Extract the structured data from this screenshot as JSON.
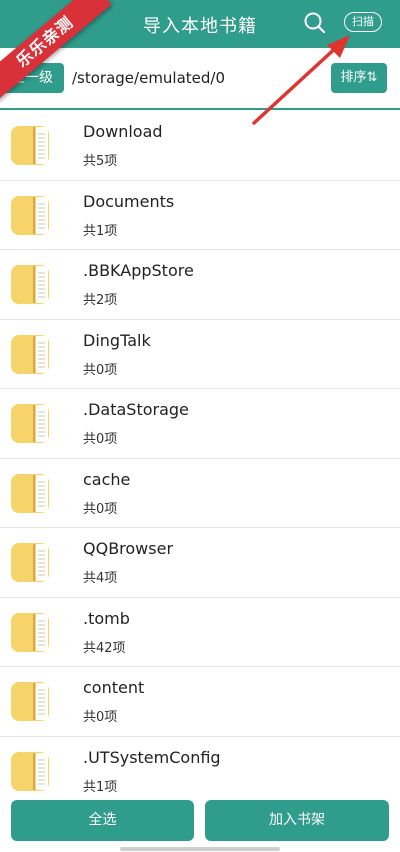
{
  "header": {
    "title": "导入本地书籍",
    "scan_label": "扫描"
  },
  "watermark": "乐乐亲测",
  "pathbar": {
    "up_label": "上一级",
    "path": "/storage/emulated/0",
    "sort_label": "排序⇅"
  },
  "folders": [
    {
      "name": "Download",
      "count": "共5项"
    },
    {
      "name": "Documents",
      "count": "共1项"
    },
    {
      "name": ".BBKAppStore",
      "count": "共2项"
    },
    {
      "name": "DingTalk",
      "count": "共0项"
    },
    {
      "name": ".DataStorage",
      "count": "共0项"
    },
    {
      "name": "cache",
      "count": "共0项"
    },
    {
      "name": "QQBrowser",
      "count": "共4项"
    },
    {
      "name": ".tomb",
      "count": "共42项"
    },
    {
      "name": "content",
      "count": "共0项"
    },
    {
      "name": ".UTSystemConfig",
      "count": "共1项"
    }
  ],
  "bottom": {
    "select_all_label": "全选",
    "add_label": "加入书架"
  },
  "colors": {
    "accent": "#2f9c8c",
    "folder": "#f7d469",
    "ribbon": "#d8313a"
  },
  "icons": {
    "search": "search-icon",
    "folder": "folder-icon",
    "arrow": "annotation-arrow"
  }
}
